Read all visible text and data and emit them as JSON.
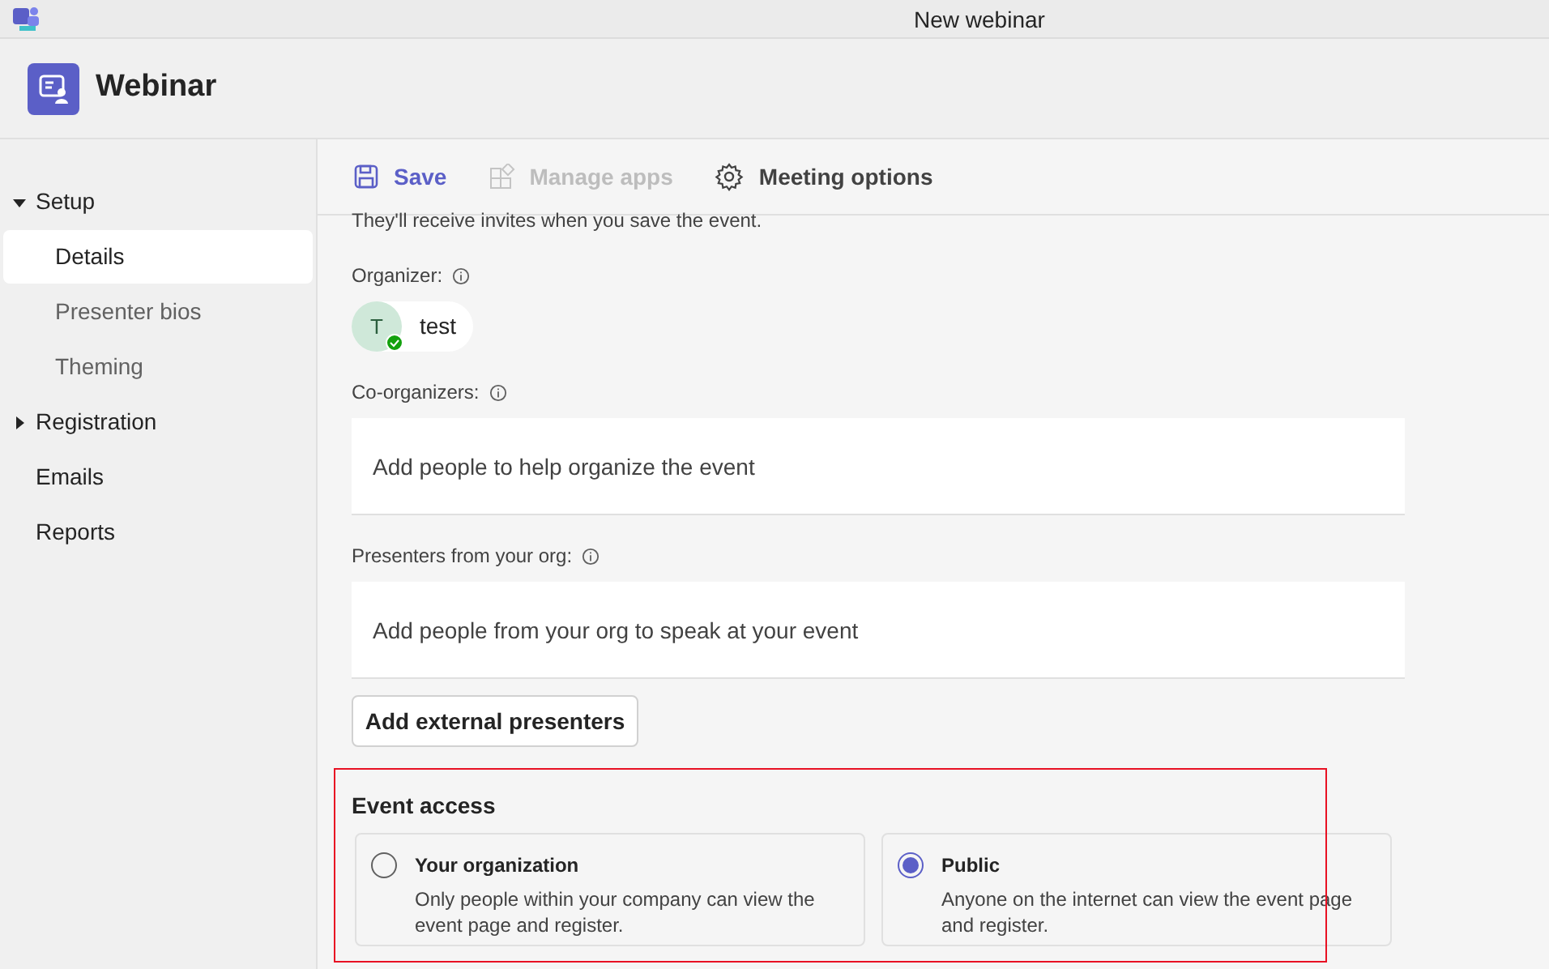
{
  "window": {
    "title": "New webinar"
  },
  "header": {
    "title": "Webinar"
  },
  "sidebar": {
    "items": [
      {
        "label": "Setup",
        "expanded": true,
        "selected": false,
        "children": [
          {
            "label": "Details",
            "selected": true
          },
          {
            "label": "Presenter bios",
            "selected": false
          },
          {
            "label": "Theming",
            "selected": false
          }
        ]
      },
      {
        "label": "Registration",
        "expanded": false,
        "selected": false
      },
      {
        "label": "Emails",
        "selected": false
      },
      {
        "label": "Reports",
        "selected": false
      }
    ]
  },
  "toolbar": [
    {
      "label": "Save",
      "kind": "save",
      "disabled": false
    },
    {
      "label": "Manage apps",
      "kind": "apps",
      "disabled": true
    },
    {
      "label": "Meeting options",
      "kind": "options",
      "disabled": false
    }
  ],
  "form": {
    "note": "They'll receive invites when you save the event.",
    "organizer": {
      "label": "Organizer:",
      "initial": "T",
      "name": "test"
    },
    "fields": [
      {
        "label": "Co-organizers:",
        "placeholder": "Add people to help organize the event"
      },
      {
        "label": "Presenters from your org:",
        "placeholder": "Add people from your org to speak at your event"
      }
    ],
    "add_button": "Add external presenters",
    "access": {
      "title": "Event access",
      "options": [
        {
          "label": "Your organization",
          "description": "Only people within your company can view the event page and register.",
          "selected": false
        },
        {
          "label": "Public",
          "description": "Anyone on the internet can view the event page and register.",
          "selected": true
        }
      ]
    }
  }
}
